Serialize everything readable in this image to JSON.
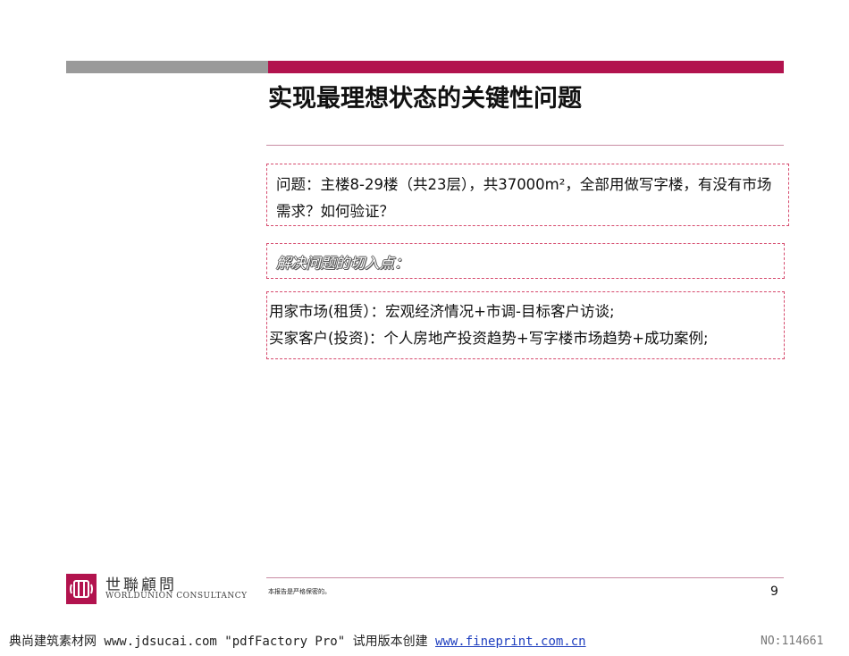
{
  "slide": {
    "title": "实现最理想状态的关键性问题",
    "question": "问题：主楼8-29楼（共23层），共37000m²，全部用做写字楼，有没有市场需求？如何验证？",
    "cut_in_label": "解决问题的切入点：",
    "approach_lines": [
      "用家市场(租赁）：宏观经济情况+市调-目标客户访谈;",
      "买家客户(投资)：个人房地产投资趋势+写字楼市场趋势+成功案例;"
    ]
  },
  "footer": {
    "logo_cn": "世聯顧問",
    "logo_en": "WORLDUNION CONSULTANCY",
    "confidential": "本报告是严格保密的。",
    "page_number": "9"
  },
  "watermark": {
    "left_text": "典尚建筑素材网 www.jdsucai.com \"pdfFactory Pro\" 试用版本创建",
    "link_text": "www.fineprint.com.cn",
    "right_text": "NO:114661"
  },
  "colors": {
    "accent": "#b2134e",
    "gray_bar": "#9a9a9a",
    "dashed_border": "#d64b6e"
  }
}
